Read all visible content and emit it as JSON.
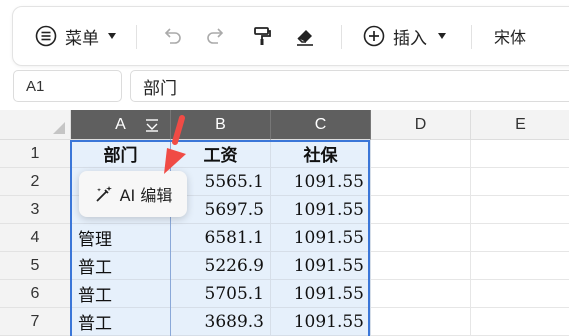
{
  "toolbar": {
    "menu_label": "菜单",
    "insert_label": "插入",
    "font_name": "宋体"
  },
  "formula_bar": {
    "cell_ref": "A1",
    "formula": "部门"
  },
  "grid": {
    "columns": [
      "A",
      "B",
      "C",
      "D",
      "E"
    ],
    "rows": [
      {
        "n": "1",
        "a": "部门",
        "b": "工资",
        "c": "社保"
      },
      {
        "n": "2",
        "a": "",
        "b": "5565.1",
        "c": "1091.55"
      },
      {
        "n": "3",
        "a": "",
        "b": "5697.5",
        "c": "1091.55"
      },
      {
        "n": "4",
        "a": "管理",
        "b": "6581.1",
        "c": "1091.55"
      },
      {
        "n": "5",
        "a": "普工",
        "b": "5226.9",
        "c": "1091.55"
      },
      {
        "n": "6",
        "a": "普工",
        "b": "5705.1",
        "c": "1091.55"
      },
      {
        "n": "7",
        "a": "普工",
        "b": "3689.3",
        "c": "1091.55"
      }
    ]
  },
  "ai_popup": {
    "label": "AI 编辑"
  },
  "colors": {
    "selection_fill": "#e6f0fb",
    "selection_border": "#3a76d8",
    "selected_header": "#5f5f5f",
    "arrow": "#f04b45"
  }
}
